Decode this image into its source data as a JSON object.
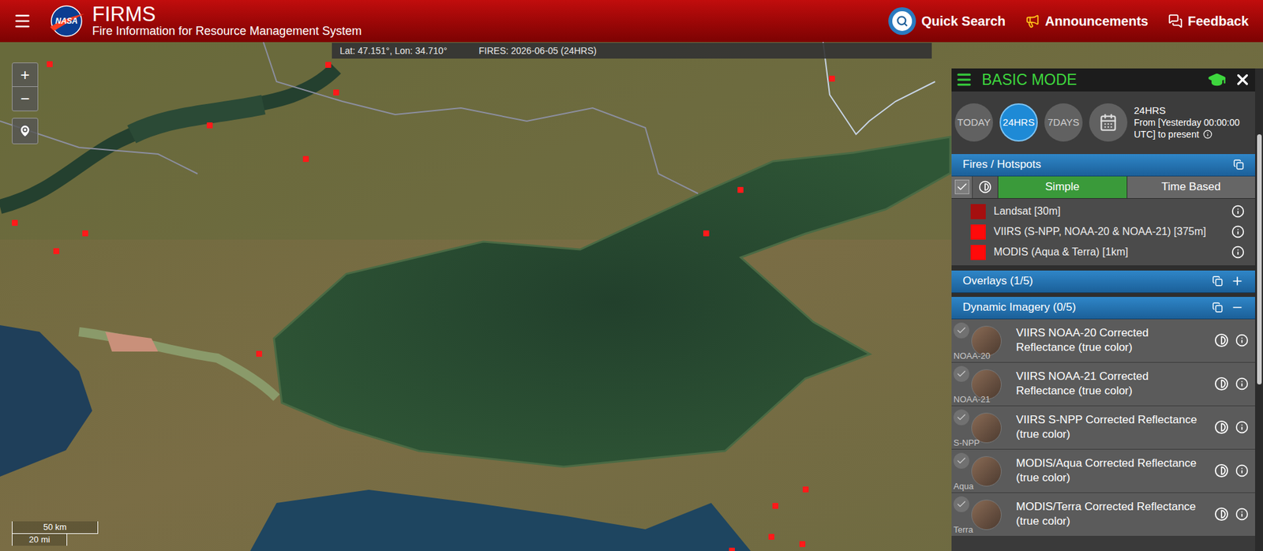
{
  "header": {
    "logo_text": "NASA",
    "title": "FIRMS",
    "subtitle": "Fire Information for Resource Management System",
    "nav": [
      {
        "label": "Quick Search"
      },
      {
        "label": "Announcements"
      },
      {
        "label": "Feedback"
      }
    ]
  },
  "map": {
    "zoom_in": "+",
    "zoom_out": "−",
    "coords": "Lat: 47.151°, Lon: 34.710°",
    "fires_label": "FIRES: 2026-06-05 (24HRS)",
    "scale": {
      "km": "50 km",
      "mi": "20 mi"
    }
  },
  "panel": {
    "mode": "BASIC MODE",
    "time_buttons": [
      {
        "label": "TODAY",
        "selected": false
      },
      {
        "label": "24HRS",
        "selected": true
      },
      {
        "label": "7DAYS",
        "selected": false
      }
    ],
    "range": {
      "title": "24HRS",
      "description": "From [Yesterday 00:00:00 UTC] to present"
    },
    "fires": {
      "title": "Fires / Hotspots",
      "checked": true,
      "display_modes": [
        {
          "label": "Simple",
          "selected": true
        },
        {
          "label": "Time Based",
          "selected": false
        }
      ],
      "sources": [
        {
          "label": "Landsat [30m]",
          "color": "#a50f0f"
        },
        {
          "label": "VIIRS (S-NPP, NOAA-20 & NOAA-21) [375m]",
          "color": "#ff0a0a"
        },
        {
          "label": "MODIS (Aqua & Terra) [1km]",
          "color": "#ff0a0a"
        }
      ]
    },
    "overlays": {
      "title": "Overlays (1/5)",
      "expanded": false
    },
    "dynamic_imagery": {
      "title": "Dynamic Imagery (0/5)",
      "expanded": true,
      "layers": [
        {
          "name": "VIIRS NOAA-20 Corrected Reflectance (true color)",
          "badge": "NOAA-20",
          "checked": false
        },
        {
          "name": "VIIRS NOAA-21 Corrected Reflectance (true color)",
          "badge": "NOAA-21",
          "checked": false
        },
        {
          "name": "VIIRS S-NPP Corrected Reflectance (true color)",
          "badge": "S-NPP",
          "checked": false
        },
        {
          "name": "MODIS/Aqua Corrected Reflectance (true color)",
          "badge": "Aqua",
          "checked": false
        },
        {
          "name": "MODIS/Terra Corrected Reflectance (true color)",
          "badge": "Terra",
          "checked": false
        }
      ]
    }
  }
}
